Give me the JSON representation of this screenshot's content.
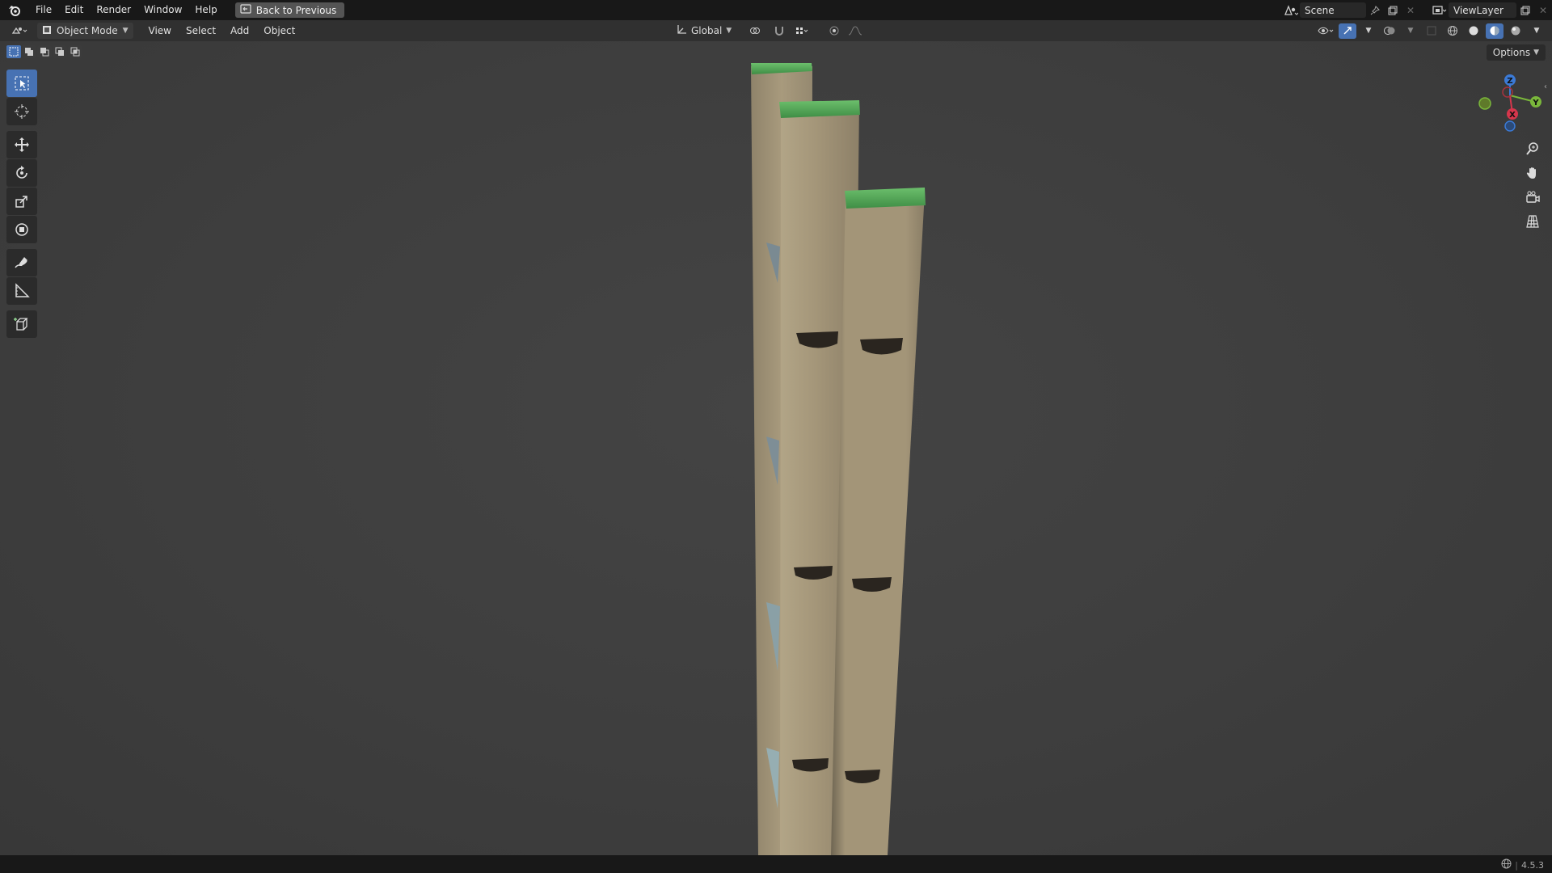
{
  "menubar": {
    "items": [
      "File",
      "Edit",
      "Render",
      "Window",
      "Help"
    ],
    "back_button": "Back to Previous",
    "scene": "Scene",
    "view_layer": "ViewLayer"
  },
  "header": {
    "mode": "Object Mode",
    "menus": [
      "View",
      "Select",
      "Add",
      "Object"
    ],
    "transform_orientation": "Global"
  },
  "viewport": {
    "options_label": "Options",
    "gizmo_axes": {
      "x": "X",
      "y": "Y",
      "z": "Z"
    }
  },
  "statusbar": {
    "version": "4.5.3"
  },
  "colors": {
    "accent": "#4772b3",
    "topbar": "#181818",
    "header": "#303030",
    "viewport": "#3d3d3d",
    "object_body": "#a39476",
    "object_cap": "#5aa85a"
  },
  "icons": {
    "logo": "blender-logo-icon",
    "tools": [
      "select-box-icon",
      "cursor-icon",
      "move-icon",
      "rotate-icon",
      "scale-icon",
      "transform-icon",
      "annotate-icon",
      "measure-icon",
      "add-cube-icon"
    ],
    "nav": [
      "zoom-icon",
      "pan-hand-icon",
      "camera-icon",
      "grid-perspective-icon"
    ]
  }
}
